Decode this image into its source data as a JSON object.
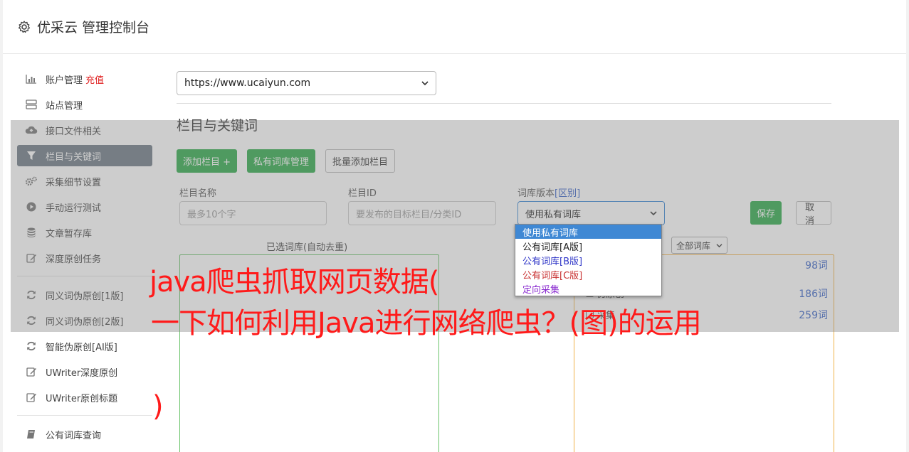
{
  "app": {
    "title": "优采云 管理控制台"
  },
  "sidebar": {
    "group1": [
      {
        "label": "账户管理",
        "extra": "充值",
        "icon": "bar-chart-icon"
      },
      {
        "label": "站点管理",
        "icon": "server-icon"
      },
      {
        "label": "接口文件相关",
        "icon": "cloud-upload-icon"
      },
      {
        "label": "栏目与关键词",
        "icon": "filter-icon",
        "active": true
      },
      {
        "label": "采集细节设置",
        "icon": "cogs-icon"
      },
      {
        "label": "手动运行测试",
        "icon": "play-circle-icon"
      },
      {
        "label": "文章暂存库",
        "icon": "database-icon"
      },
      {
        "label": "深度原创任务",
        "icon": "edit-icon"
      }
    ],
    "group2": [
      {
        "label": "同义词伪原创[1版]",
        "icon": "refresh-icon"
      },
      {
        "label": "同义词伪原创[2版]",
        "icon": "refresh-icon"
      },
      {
        "label": "智能伪原创[AI版]",
        "icon": "refresh-icon"
      },
      {
        "label": "UWriter深度原创",
        "icon": "edit-icon"
      },
      {
        "label": "UWriter原创标题",
        "icon": "edit-icon"
      }
    ],
    "group3": [
      {
        "label": "公有词库查询",
        "icon": "book-icon"
      }
    ]
  },
  "main": {
    "site_select": "https://www.ucaiyun.com",
    "section_title": "栏目与关键词",
    "buttons": {
      "add_column": "添加栏目 +",
      "private_lib": "私有词库管理",
      "batch_add": "批量添加栏目"
    },
    "form": {
      "name_label": "栏目名称",
      "name_placeholder": "最多10个字",
      "id_label": "栏目ID",
      "id_placeholder": "要发布的目标栏目/分类ID",
      "version_label": "词库版本",
      "version_diff": "[区别]",
      "version_value": "使用私有词库",
      "save": "保存",
      "cancel": "取消"
    },
    "selected_label": "已选词库(自动去重)",
    "filter_select": "全部词库",
    "lib_rows": [
      {
        "label": "",
        "count": "98词"
      },
      {
        "label": "伪原创",
        "count": "186词"
      },
      {
        "label": "采集",
        "count": "259词"
      }
    ]
  },
  "dropdown": {
    "options": [
      {
        "label": "使用私有词库",
        "style": "sel"
      },
      {
        "label": "公有词库[A版]",
        "style": ""
      },
      {
        "label": "公有词库[B版]",
        "style": "blue"
      },
      {
        "label": "公有词库[C版]",
        "style": "red"
      },
      {
        "label": "定向采集",
        "style": "purple"
      }
    ]
  },
  "watermark": {
    "line1": "java爬虫抓取网页数据(",
    "line2": "一下如何利用Java进行网络爬虫？(图)的运用",
    "line3": ")"
  }
}
